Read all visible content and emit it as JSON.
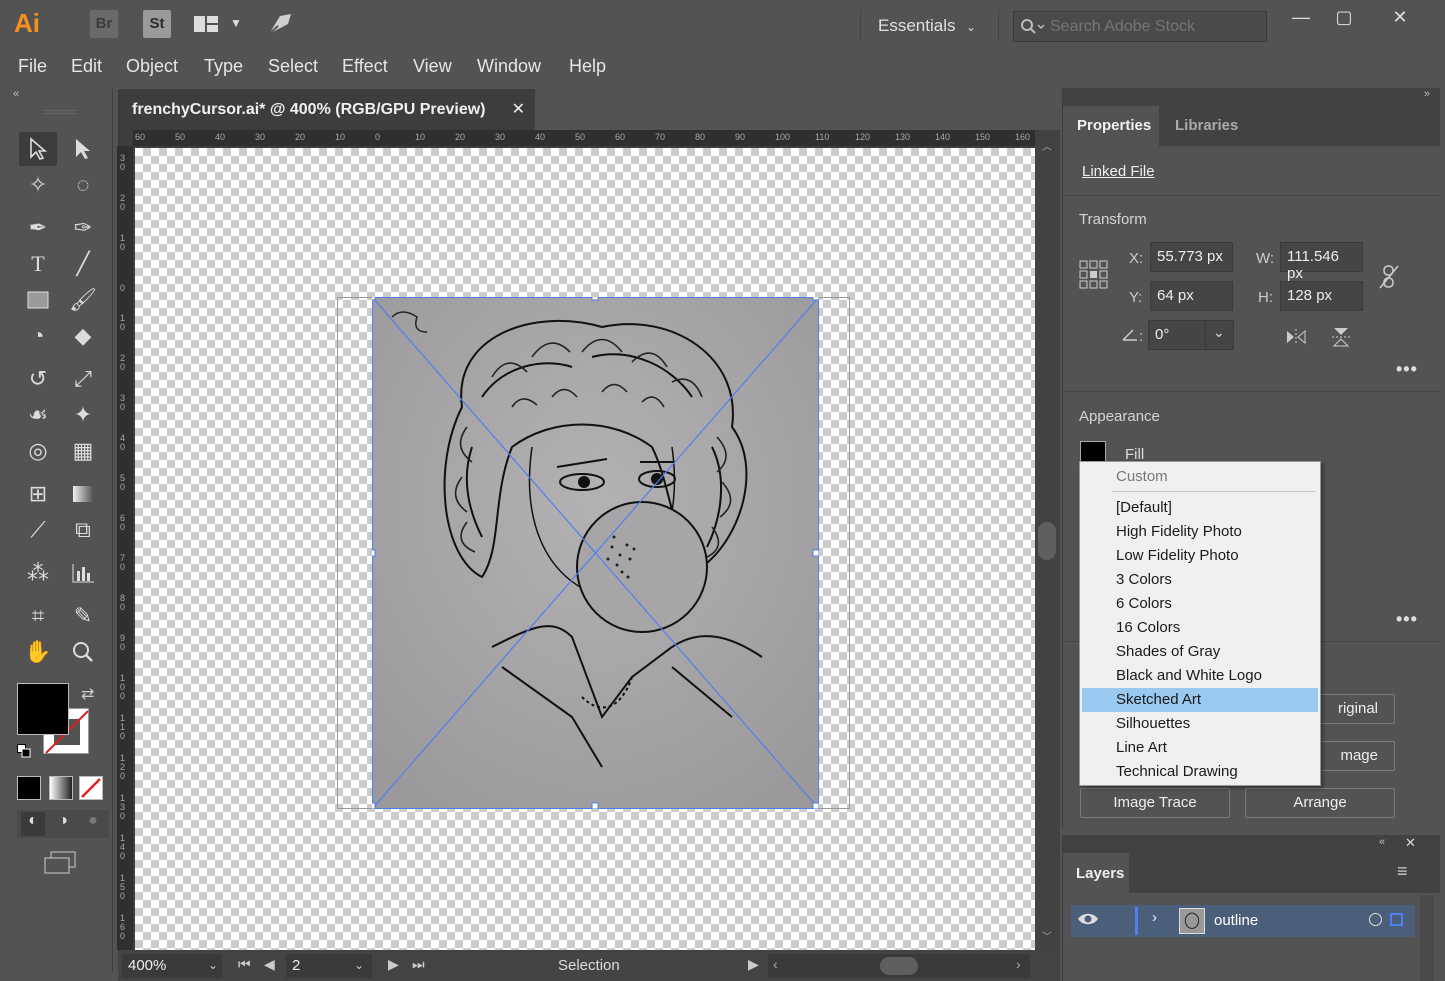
{
  "app": {
    "logo": "Ai",
    "bridge_label": "Br",
    "stock_label": "St",
    "workspace": "Essentials",
    "search_placeholder": "Search Adobe Stock",
    "minimize": "—",
    "maximize": "▢",
    "close": "✕"
  },
  "menu": [
    "File",
    "Edit",
    "Object",
    "Type",
    "Select",
    "Effect",
    "View",
    "Window",
    "Help"
  ],
  "document": {
    "tab_title": "frenchyCursor.ai* @ 400% (RGB/GPU Preview)",
    "close": "✕",
    "ruler_top": [
      "60",
      "50",
      "40",
      "30",
      "20",
      "10",
      "0",
      "10",
      "20",
      "30",
      "40",
      "50",
      "60",
      "70",
      "80",
      "90",
      "100",
      "110",
      "120",
      "130",
      "140",
      "150",
      "160"
    ],
    "ruler_left": [
      "3 0",
      "2 0",
      "1 0",
      "0",
      "1 0",
      "2 0",
      "3 0",
      "4 0",
      "5 0",
      "6 0",
      "7 0",
      "8 0",
      "9 0",
      "1 0 0",
      "1 1 0",
      "1 2 0",
      "1 3 0",
      "1 4 0",
      "1 5 0",
      "1 6 0"
    ]
  },
  "status": {
    "zoom": "400%",
    "artboard": "2",
    "mode": "Selection"
  },
  "properties": {
    "tabs": [
      "Properties",
      "Libraries"
    ],
    "linked_file": "Linked File",
    "transform_title": "Transform",
    "x_label": "X:",
    "x_value": "55.773 px",
    "y_label": "Y:",
    "y_value": "64 px",
    "w_label": "W:",
    "w_value": "111.546 px",
    "h_label": "H:",
    "h_value": "128 px",
    "angle_label": ":",
    "angle_value": "0°",
    "appearance_title": "Appearance",
    "fill_label": "Fill",
    "original_btn_partial": "riginal",
    "image_btn_partial": "mage",
    "image_trace_btn": "Image Trace",
    "arrange_btn": "Arrange",
    "more": "•••"
  },
  "trace_dropdown": {
    "header": "Custom",
    "options": [
      "[Default]",
      "High Fidelity Photo",
      "Low Fidelity Photo",
      "3 Colors",
      "6 Colors",
      "16 Colors",
      "Shades of Gray",
      "Black and White Logo",
      "Sketched Art",
      "Silhouettes",
      "Line Art",
      "Technical Drawing"
    ],
    "selected": "Sketched Art"
  },
  "layers": {
    "title": "Layers",
    "layer_name": "outline"
  },
  "colors": {
    "ui_bg": "#535353",
    "doc_bg": "#3d3d3d",
    "selection_blue": "#4f7ff0",
    "highlight": "#99c9ef",
    "brand_orange": "#f7901e"
  }
}
